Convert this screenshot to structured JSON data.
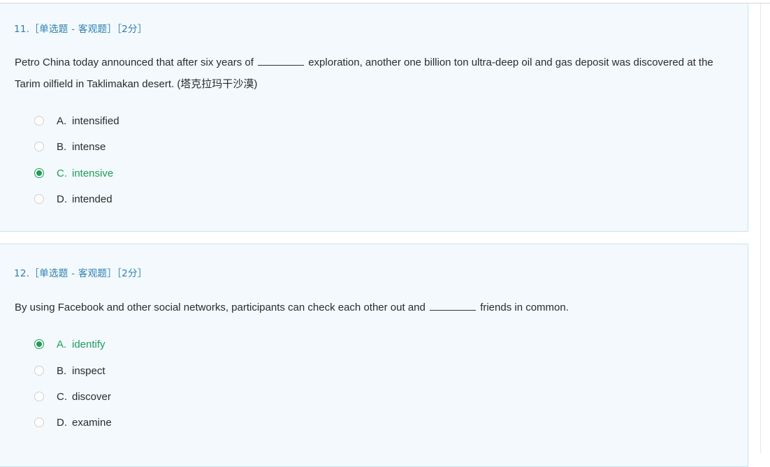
{
  "questions": [
    {
      "header": "11.［单选题 - 客观题］［2分］",
      "stem_part1": "Petro China today announced that after six years of",
      "stem_part2": "exploration, another one billion ton ultra-deep oil and gas deposit was discovered at the Tarim oilfield in Taklimakan desert. (塔克拉玛干沙漠)",
      "options": [
        {
          "letter": "A.",
          "text": "intensified",
          "selected": false
        },
        {
          "letter": "B.",
          "text": "intense",
          "selected": false
        },
        {
          "letter": "C.",
          "text": "intensive",
          "selected": true
        },
        {
          "letter": "D.",
          "text": "intended",
          "selected": false
        }
      ]
    },
    {
      "header": "12.［单选题 - 客观题］［2分］",
      "stem_part1": "By using Facebook and other social networks, participants can check each other out and",
      "stem_part2": "friends in common.",
      "options": [
        {
          "letter": "A.",
          "text": "identify",
          "selected": true
        },
        {
          "letter": "B.",
          "text": "inspect",
          "selected": false
        },
        {
          "letter": "C.",
          "text": "discover",
          "selected": false
        },
        {
          "letter": "D.",
          "text": "examine",
          "selected": false
        }
      ]
    }
  ],
  "colors": {
    "selected": "#1e9d58",
    "header": "#2c7fb0",
    "card_background": "#f3f9fd",
    "card_border": "#c9e4ee"
  },
  "icons": {
    "radio_unchecked": "radio-unchecked-icon",
    "radio_checked": "radio-checked-icon"
  }
}
